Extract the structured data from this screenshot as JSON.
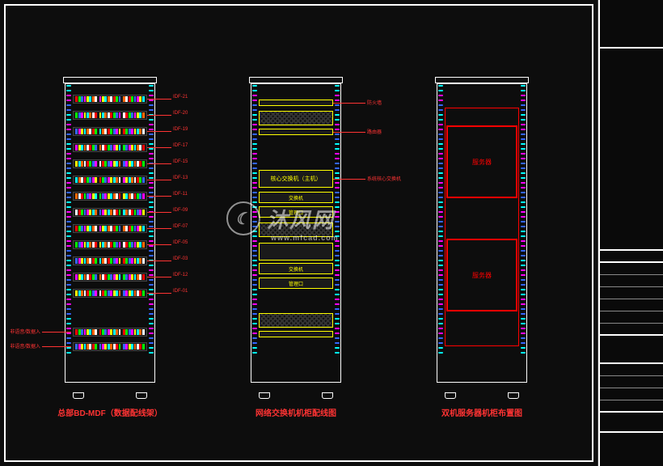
{
  "racks": {
    "rack1": {
      "title": "总部BD-MDF（数据配线架）",
      "labels": [
        "IDF-21",
        "IDF-20",
        "IDF-19",
        "IDF-17",
        "IDF-15",
        "IDF-13",
        "IDF-11",
        "IDF-09",
        "IDF-07",
        "IDF-05",
        "IDF-03",
        "IDF-12",
        "IDF-01"
      ],
      "bottom_labels": [
        "非语音/数据入",
        "非语音/数据入"
      ]
    },
    "rack2": {
      "title": "网络交换机机柜配线图",
      "fw": "防火墙",
      "router": "路由器",
      "core1": "核心交换机（主机）",
      "core_label": "系统核心交换机",
      "sw1": "交换机",
      "mgmt1": "管理口",
      "sw2": "交换机",
      "mgmt2": "管理口"
    },
    "rack3": {
      "title": "双机服务器机柜布置图",
      "server1": "服务器",
      "server2": "服务器"
    }
  },
  "watermark": {
    "main": "沐风网",
    "sub": "www.mfcad.com"
  },
  "colors": {
    "cyan": "#00ffff",
    "magenta": "#ff00ff",
    "blue": "#3366ff",
    "yellow": "#ffff00",
    "red": "#ff0000",
    "orange": "#ff6600"
  }
}
